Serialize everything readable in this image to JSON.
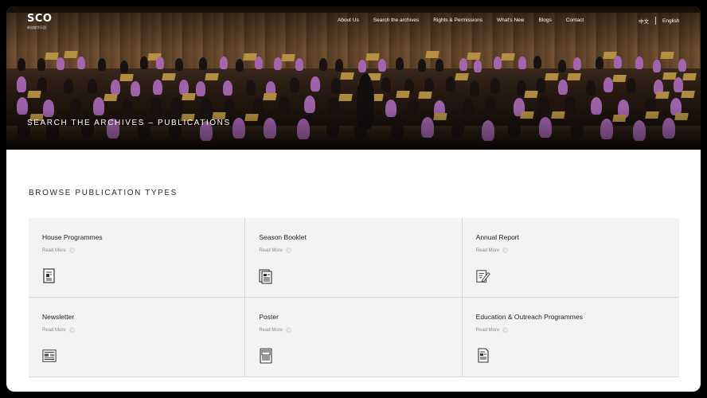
{
  "logo": {
    "main": "SCO",
    "sub": "新加坡华乐团"
  },
  "nav": {
    "items": [
      "About Us",
      "Search the archives",
      "Rights & Permissions",
      "What's New",
      "Blogs",
      "Contact"
    ]
  },
  "languages": {
    "chinese": "中文",
    "english": "English"
  },
  "hero": {
    "title": "SEARCH THE ARCHIVES – PUBLICATIONS"
  },
  "section": {
    "title": "BROWSE PUBLICATION TYPES"
  },
  "cards": [
    {
      "title": "House Programmes",
      "link": "Read More",
      "icon": "programme-doc-icon"
    },
    {
      "title": "Season Booklet",
      "link": "Read More",
      "icon": "booklet-icon"
    },
    {
      "title": "Annual Report",
      "link": "Read More",
      "icon": "report-edit-icon"
    },
    {
      "title": "Newsletter",
      "link": "Read More",
      "icon": "newspaper-icon"
    },
    {
      "title": "Poster",
      "link": "Read More",
      "icon": "poster-icon"
    },
    {
      "title": "Education & Outreach Programmes",
      "link": "Read More",
      "icon": "document-icon"
    }
  ],
  "colors": {
    "heading": "#1e2a3a",
    "card_bg": "#f3f3f3",
    "accent_gold": "#c9a14a",
    "musician_purple": "#b872c4"
  }
}
